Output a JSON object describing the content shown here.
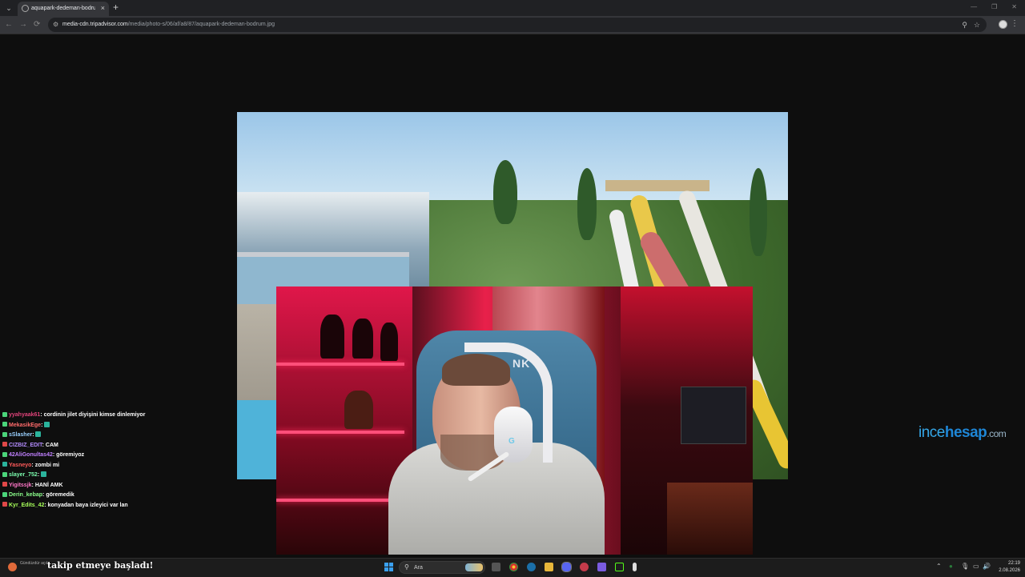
{
  "browser": {
    "tab_title": "aquapark-dedeman-bodrum.jpg",
    "tab_close": "×",
    "new_tab": "+",
    "url_host": "media-cdn.tripadvisor.com",
    "url_path": "/media/photo-s/06/af/a8/87/aquapark-dedeman-bodrum.jpg",
    "icons": {
      "back": "←",
      "forward": "→",
      "reload": "⟳",
      "site_info": "⚙",
      "zoom": "⚲",
      "bookmark": "☆",
      "menu": "⋮",
      "tab_search": "⌄"
    },
    "window_controls": [
      "—",
      "❐",
      "✕"
    ]
  },
  "stream": {
    "chair_text": "NK",
    "headset_logo": "G"
  },
  "chat": [
    {
      "user": "yyahyaak61",
      "user_color": "#e0437a",
      "badge_color": "#4bd47a",
      "message": "cordinin jilet diyişini kimse dinlemiyor",
      "emote": false
    },
    {
      "user": "MekasikEge",
      "user_color": "#ff6b6b",
      "badge_color": "#4bd47a",
      "message": "",
      "emote": true
    },
    {
      "user": "sSlasher",
      "user_color": "#9ad0ff",
      "badge_color": "#4bd47a",
      "message": "",
      "emote": true
    },
    {
      "user": "CIZBIZ_EDIT",
      "user_color": "#b48cff",
      "badge_color": "#e04848",
      "message": "CAM",
      "emote": false
    },
    {
      "user": "42AliGonultas42",
      "user_color": "#c080ff",
      "badge_color": "#4bd47a",
      "message": "göremiyoz",
      "emote": false
    },
    {
      "user": "Yasneyo",
      "user_color": "#ff5a5a",
      "badge_color": "#2bb39c",
      "message": "zombi mi",
      "emote": false
    },
    {
      "user": "slayer_752",
      "user_color": "#7dffb0",
      "badge_color": "#4bd47a",
      "message": "",
      "emote": true
    },
    {
      "user": "Yigitssjk",
      "user_color": "#ff77c8",
      "badge_color": "#e04848",
      "message": "HANİ AMK",
      "emote": false
    },
    {
      "user": "Derin_kebap",
      "user_color": "#8cff8c",
      "badge_color": "#4bd47a",
      "message": "göremedik",
      "emote": false
    },
    {
      "user": "Kyr_Edits_42",
      "user_color": "#a8ff5a",
      "badge_color": "#e04848",
      "message": "konyadan baya izleyici var lan",
      "emote": false
    }
  ],
  "watermark": {
    "part1": "ince",
    "part2": "hesap",
    "part3": ".com"
  },
  "notification": {
    "title": "takip etmeye başladı!",
    "sub": "Gündüzdür açık"
  },
  "taskbar": {
    "search_label": "Ara",
    "search_icon": "⚲",
    "tray_icons": [
      "⌃",
      "●",
      "🎙",
      "▭",
      "🔊"
    ],
    "time": "22:19",
    "date": "2.08.2026"
  },
  "colors": {
    "accent": "#1e86d6",
    "background": "#0e0e0e"
  }
}
